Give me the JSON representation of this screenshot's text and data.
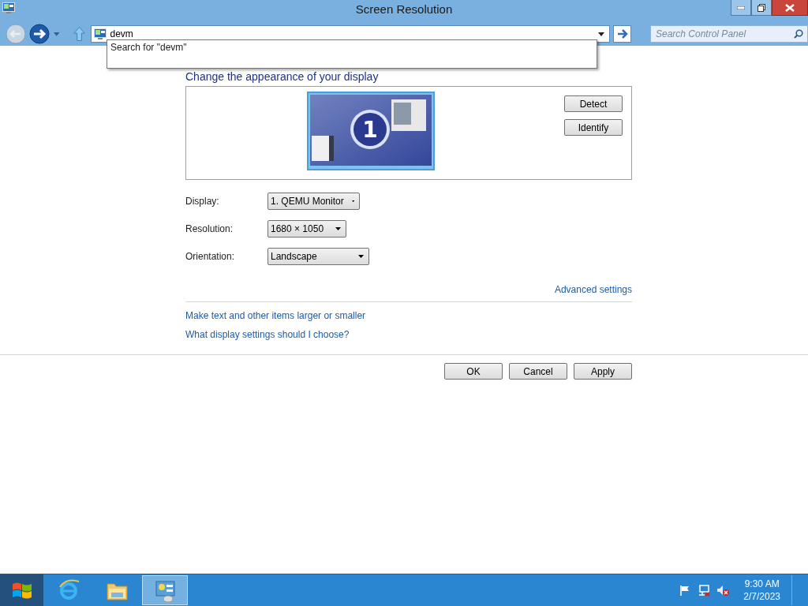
{
  "window": {
    "title": "Screen Resolution"
  },
  "address": {
    "value": "devm",
    "suggestion": "Search for \"devm\""
  },
  "search": {
    "placeholder": "Search Control Panel"
  },
  "heading": "Change the appearance of your display",
  "preview_buttons": [
    "Detect",
    "Identify"
  ],
  "monitor": {
    "number": "1"
  },
  "settings": [
    {
      "label": "Display:",
      "value": "1. QEMU Monitor"
    },
    {
      "label": "Resolution:",
      "value": "1680 × 1050"
    },
    {
      "label": "Orientation:",
      "value": "Landscape"
    }
  ],
  "advanced_link": "Advanced settings",
  "links": [
    "Make text and other items larger or smaller",
    "What display settings should I choose?"
  ],
  "buttons": [
    "OK",
    "Cancel",
    "Apply"
  ],
  "taskbar": {
    "apps": [
      {
        "kind": "browser",
        "selected": false
      },
      {
        "kind": "folder",
        "selected": false
      },
      {
        "kind": "control-panel",
        "selected": true
      }
    ],
    "time": "9:30 AM",
    "date": "2/7/2023"
  }
}
